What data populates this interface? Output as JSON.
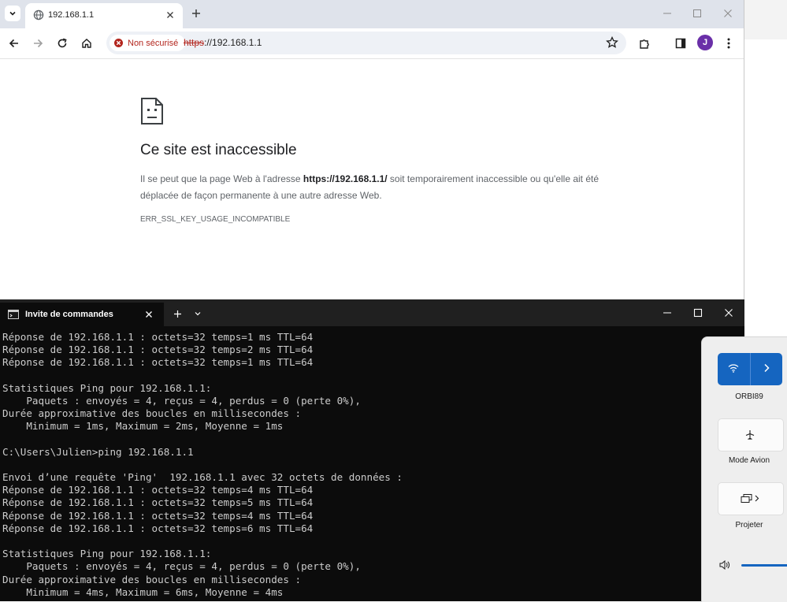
{
  "browser": {
    "tab": {
      "title": "192.168.1.1"
    },
    "address_bar": {
      "security_label": "Non sécurisé",
      "url_scheme": "https",
      "url_rest": "://192.168.1.1"
    },
    "avatar_initial": "J",
    "error": {
      "title": "Ce site est inaccessible",
      "desc_prefix": "Il se peut que la page Web à l'adresse ",
      "desc_url": "https://192.168.1.1/",
      "desc_suffix": " soit temporairement inaccessible ou qu'elle ait été déplacée de façon permanente à une autre adresse Web.",
      "code": "ERR_SSL_KEY_USAGE_INCOMPATIBLE"
    }
  },
  "terminal": {
    "tab_title": "Invite de commandes",
    "lines": [
      "Réponse de 192.168.1.1 : octets=32 temps=1 ms TTL=64",
      "Réponse de 192.168.1.1 : octets=32 temps=2 ms TTL=64",
      "Réponse de 192.168.1.1 : octets=32 temps=1 ms TTL=64",
      "",
      "Statistiques Ping pour 192.168.1.1:",
      "    Paquets : envoyés = 4, reçus = 4, perdus = 0 (perte 0%),",
      "Durée approximative des boucles en millisecondes :",
      "    Minimum = 1ms, Maximum = 2ms, Moyenne = 1ms",
      "",
      "C:\\Users\\Julien>ping 192.168.1.1",
      "",
      "Envoi d’une requête 'Ping'  192.168.1.1 avec 32 octets de données :",
      "Réponse de 192.168.1.1 : octets=32 temps=4 ms TTL=64",
      "Réponse de 192.168.1.1 : octets=32 temps=5 ms TTL=64",
      "Réponse de 192.168.1.1 : octets=32 temps=4 ms TTL=64",
      "Réponse de 192.168.1.1 : octets=32 temps=6 ms TTL=64",
      "",
      "Statistiques Ping pour 192.168.1.1:",
      "    Paquets : envoyés = 4, reçus = 4, perdus = 0 (perte 0%),",
      "Durée approximative des boucles en millisecondes :",
      "    Minimum = 4ms, Maximum = 6ms, Moyenne = 4ms"
    ]
  },
  "quick_settings": {
    "wifi_label": "ORBI89",
    "airplane_label": "Mode Avion",
    "project_label": "Projeter",
    "accent_color": "#1565c0"
  }
}
